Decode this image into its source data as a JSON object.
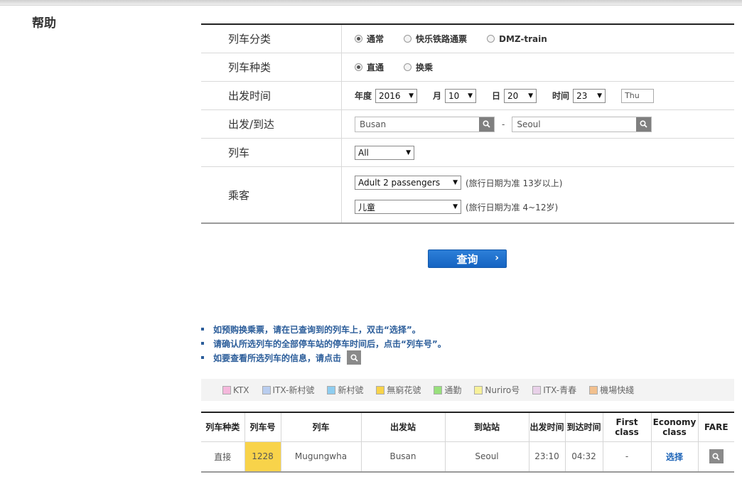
{
  "page": {
    "help_title": "帮助"
  },
  "form": {
    "category": {
      "label": "列车分类",
      "options": [
        "通常",
        "快乐铁路通票",
        "DMZ-train"
      ],
      "selected": "通常"
    },
    "route_type": {
      "label": "列车种类",
      "options": [
        "直通",
        "换乘"
      ],
      "selected": "直通"
    },
    "departure_time": {
      "label": "出发时间",
      "year_label": "年度",
      "year": "2016",
      "month_label": "月",
      "month": "10",
      "day_label": "日",
      "day": "20",
      "hour_label": "时间",
      "hour": "23",
      "weekday": "Thu"
    },
    "stations": {
      "label": "出发/到达",
      "from": "Busan",
      "separator": "-",
      "to": "Seoul"
    },
    "train": {
      "label": "列车",
      "value": "All"
    },
    "passengers": {
      "label": "乘客",
      "adult": "Adult 2 passengers",
      "adult_note": "(旅行日期为准 13岁以上)",
      "child": "儿童",
      "child_note": "(旅行日期为准 4~12岁)"
    }
  },
  "search_button": {
    "label": "查询",
    "chevron": "›"
  },
  "notes": [
    "如预购换乘票，请在已查询到的列车上，双击“选择”。",
    "请确认所选列车的全部停车站的停车时间后，点击“列车号”。",
    "如要查看所选列车的信息，请点击"
  ],
  "legend": [
    {
      "label": "KTX",
      "color": "#f5b8dc"
    },
    {
      "label": "ITX-新村號",
      "color": "#b9cdef"
    },
    {
      "label": "新村號",
      "color": "#8ecdf0"
    },
    {
      "label": "無窮花號",
      "color": "#f8d34a"
    },
    {
      "label": "通勤",
      "color": "#98e07c"
    },
    {
      "label": "Nuriro号",
      "color": "#f7f19a"
    },
    {
      "label": "ITX-青春",
      "color": "#e9d1e9"
    },
    {
      "label": "機場快綫",
      "color": "#f2c08e"
    }
  ],
  "table": {
    "headers": [
      "列车种类",
      "列车号",
      "列车",
      "出发站",
      "到站站",
      "出发时间",
      "到达时间",
      "First class",
      "Economy class",
      "FARE"
    ],
    "rows": [
      {
        "type": "直接",
        "number": "1228",
        "train": "Mugungwha",
        "from": "Busan",
        "to": "Seoul",
        "dep": "23:10",
        "arr": "04:32",
        "first": "-",
        "economy": "选择"
      }
    ]
  },
  "icons": {
    "search": "search-icon",
    "dropdown": "dropdown-arrow-icon"
  }
}
